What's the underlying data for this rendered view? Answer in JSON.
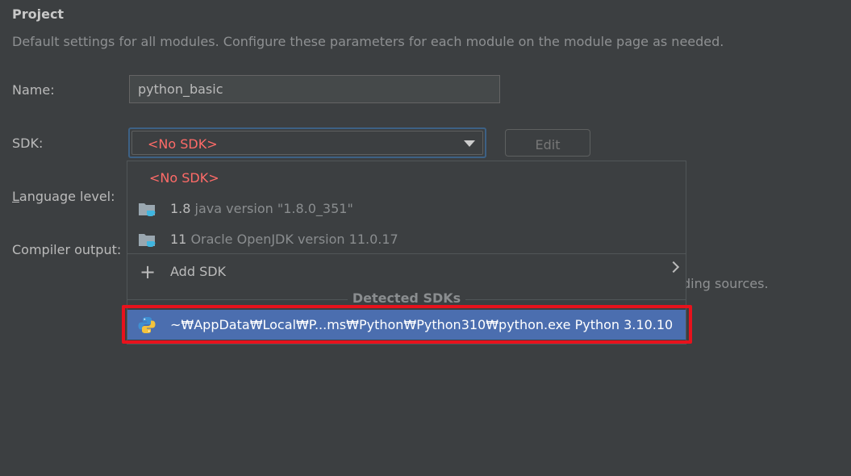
{
  "section": {
    "title": "Project",
    "description": "Default settings for all modules. Configure these parameters for each module on the module page as needed."
  },
  "fields": {
    "name_label": "Name:",
    "name_value": "python_basic",
    "sdk_label": "SDK:",
    "sdk_value": "<No SDK>",
    "edit_label": "Edit",
    "language_level_mnemonic": "L",
    "language_level_rest": "anguage level:",
    "compiler_output_label": "Compiler output:",
    "compiler_hint_partial": "ding sources."
  },
  "popup": {
    "no_sdk": "<No SDK>",
    "items": [
      {
        "version": "1.8",
        "description": "java version \"1.8.0_351\"",
        "icon": "folder-jdk-icon"
      },
      {
        "version": "11",
        "description": "Oracle OpenJDK version 11.0.17",
        "icon": "folder-jdk-icon"
      }
    ],
    "add_sdk": "Add SDK",
    "detected_header": "Detected SDKs",
    "detected_item": "~₩AppData₩Local₩P...ms₩Python₩Python310₩python.exe Python 3.10.10"
  },
  "colors": {
    "background": "#3c3f41",
    "error_red": "#ff6b68",
    "selection": "#4b6eaf",
    "highlight_box": "#e8121c"
  }
}
